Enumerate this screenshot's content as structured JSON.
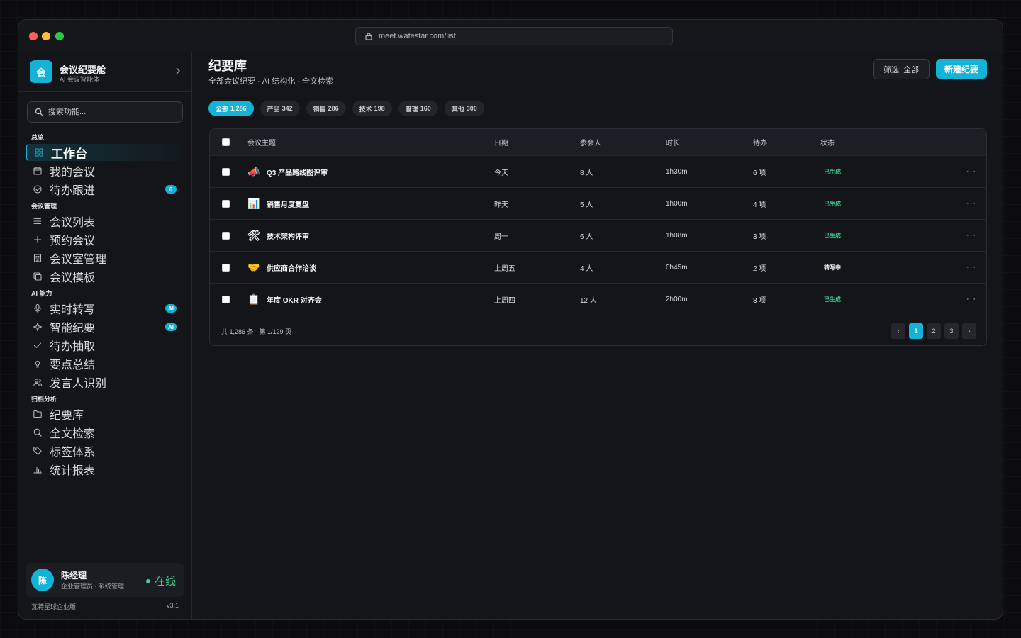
{
  "browser": {
    "url": "meet.watestar.com/list"
  },
  "brand": {
    "logo_text": "会",
    "name": "会议纪要舱",
    "subtitle": "AI 会议智能体"
  },
  "search": {
    "placeholder": "搜索功能..."
  },
  "nav": {
    "groups": [
      {
        "label": "总览",
        "items": [
          {
            "label": "工作台",
            "icon": "grid-icon",
            "active": true
          },
          {
            "label": "我的会议",
            "icon": "calendar-icon"
          },
          {
            "label": "待办跟进",
            "icon": "check-circle-icon",
            "badge": "6"
          }
        ]
      },
      {
        "label": "会议管理",
        "items": [
          {
            "label": "会议列表",
            "icon": "list-icon"
          },
          {
            "label": "预约会议",
            "icon": "plus-icon"
          },
          {
            "label": "会议室管理",
            "icon": "building-icon"
          },
          {
            "label": "会议模板",
            "icon": "copy-icon"
          }
        ]
      },
      {
        "label": "AI 能力",
        "items": [
          {
            "label": "实时转写",
            "icon": "mic-icon",
            "badge": "AI"
          },
          {
            "label": "智能纪要",
            "icon": "sparkle-icon",
            "badge": "AI"
          },
          {
            "label": "待办抽取",
            "icon": "check-icon"
          },
          {
            "label": "要点总结",
            "icon": "lightbulb-icon"
          },
          {
            "label": "发言人识别",
            "icon": "users-icon"
          }
        ]
      },
      {
        "label": "归档分析",
        "items": [
          {
            "label": "纪要库",
            "icon": "folder-icon"
          },
          {
            "label": "全文检索",
            "icon": "search-icon"
          },
          {
            "label": "标签体系",
            "icon": "tag-icon"
          },
          {
            "label": "统计报表",
            "icon": "bar-chart-icon"
          }
        ]
      }
    ]
  },
  "user": {
    "avatar": "陈",
    "name": "陈经理",
    "role": "企业管理员 · 系统管理",
    "status": "在线"
  },
  "footer": {
    "edition": "瓦特星球企业版",
    "version": "v3.1"
  },
  "page": {
    "title": "纪要库",
    "subtitle": "全部会议纪要 · AI 结构化 · 全文检索",
    "filter_label": "筛选: 全部",
    "new_label": "新建纪要"
  },
  "chips": [
    {
      "label": "全部",
      "count": "1,286",
      "active": true
    },
    {
      "label": "产品",
      "count": "342"
    },
    {
      "label": "销售",
      "count": "286"
    },
    {
      "label": "技术",
      "count": "198"
    },
    {
      "label": "管理",
      "count": "160"
    },
    {
      "label": "其他",
      "count": "300"
    }
  ],
  "table": {
    "headers": {
      "topic": "会议主题",
      "date": "日期",
      "people": "参会人",
      "duration": "时长",
      "todo": "待办",
      "status": "状态"
    },
    "rows": [
      {
        "emoji": "📣",
        "topic": "Q3 产品路线图评审",
        "date": "今天",
        "people": "8 人",
        "duration": "1h30m",
        "todo": "6 项",
        "status": "已生成",
        "status_type": "done"
      },
      {
        "emoji": "📊",
        "topic": "销售月度复盘",
        "date": "昨天",
        "people": "5 人",
        "duration": "1h00m",
        "todo": "4 项",
        "status": "已生成",
        "status_type": "done"
      },
      {
        "emoji": "🛠",
        "topic": "技术架构评审",
        "date": "周一",
        "people": "6 人",
        "duration": "1h08m",
        "todo": "3 项",
        "status": "已生成",
        "status_type": "done"
      },
      {
        "emoji": "🤝",
        "topic": "供应商合作洽谈",
        "date": "上周五",
        "people": "4 人",
        "duration": "0h45m",
        "todo": "2 项",
        "status": "转写中",
        "status_type": "trans"
      },
      {
        "emoji": "📋",
        "topic": "年度 OKR 对齐会",
        "date": "上周四",
        "people": "12 人",
        "duration": "2h00m",
        "todo": "8 项",
        "status": "已生成",
        "status_type": "done"
      }
    ],
    "more_label": "···",
    "total": "共 1,286 条 · 第 1/129 页",
    "pages": {
      "prev": "‹",
      "next": "›",
      "items": [
        "1",
        "2",
        "3"
      ],
      "current": "1"
    }
  },
  "colors": {
    "accent": "#12b3d6",
    "success": "#3ccf8e",
    "background": "#141519"
  }
}
